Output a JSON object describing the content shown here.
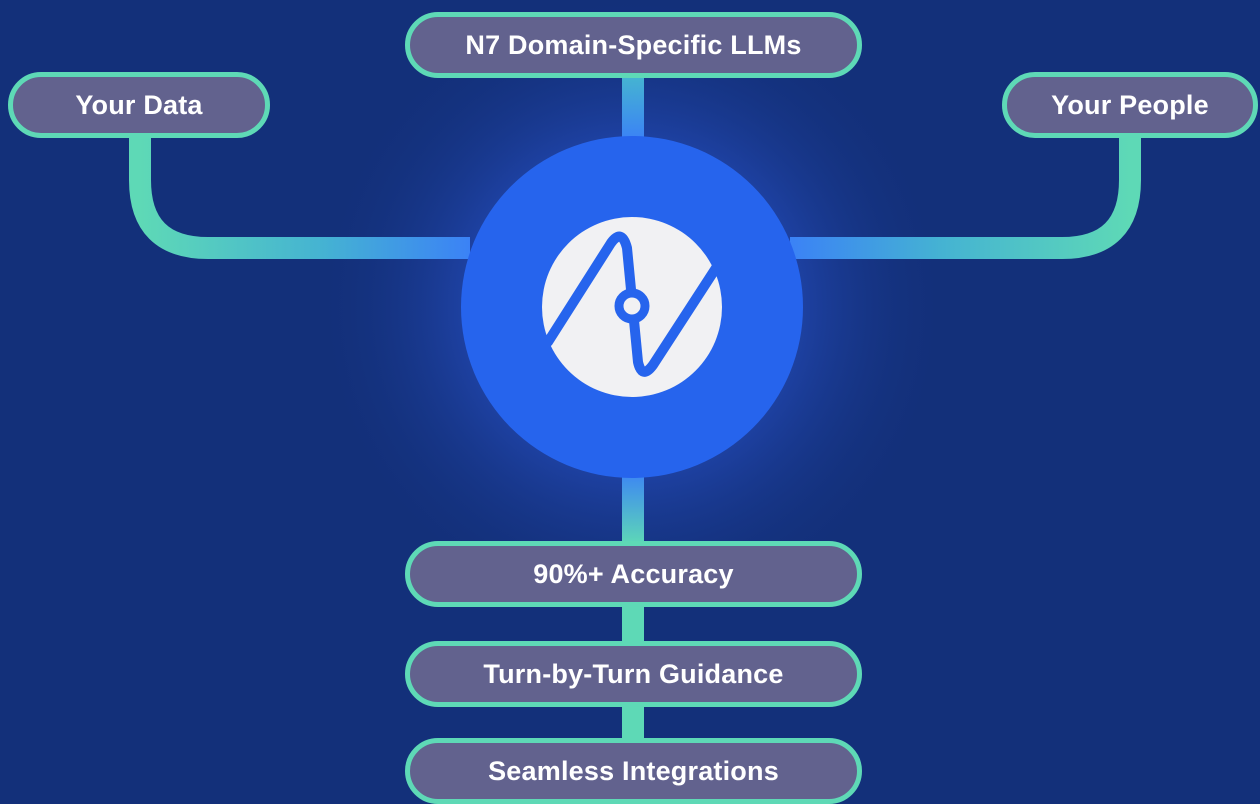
{
  "hub": {
    "logo_icon": "n7-logo-icon"
  },
  "nodes": {
    "llms": "N7 Domain-Specific LLMs",
    "data": "Your Data",
    "people": "Your People",
    "accuracy": "90%+ Accuracy",
    "guidance": "Turn-by-Turn Guidance",
    "integrations": "Seamless Integrations"
  },
  "colors": {
    "background": "#13307a",
    "pill_fill": "#62628e",
    "pill_border": "#5ed9b6",
    "hub_blue": "#2664ed",
    "connector_blue": "#3b82f6",
    "connector_teal": "#5ed9b6",
    "logo_disc": "#f1f1f3"
  }
}
